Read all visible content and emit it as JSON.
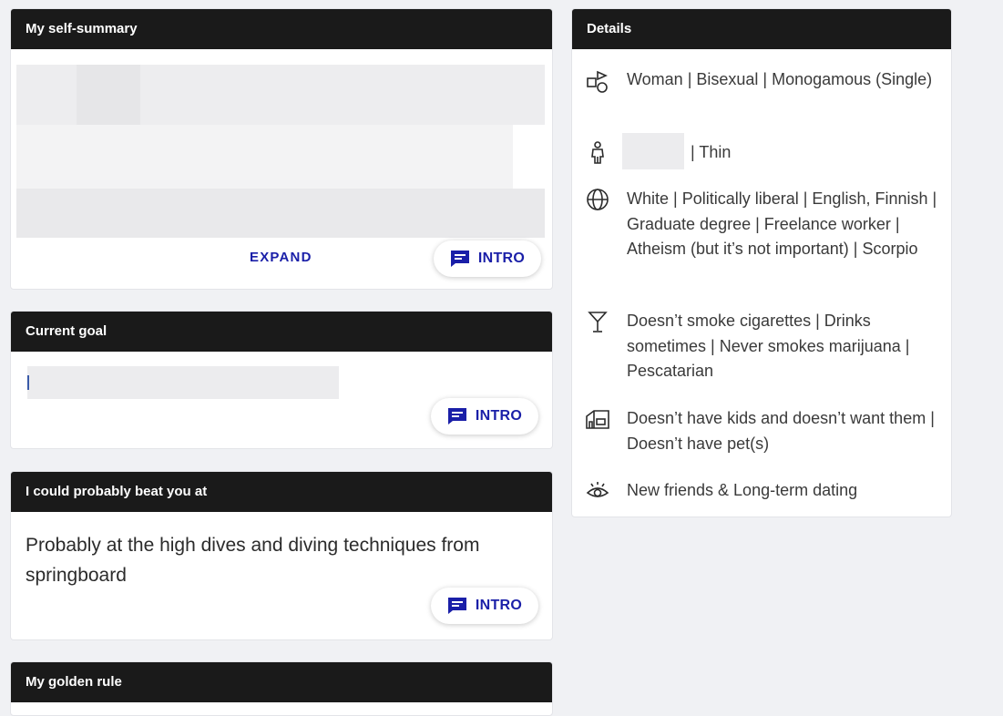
{
  "self_summary": {
    "title": "My self-summary",
    "expand_label": "EXPAND",
    "intro_label": "INTRO"
  },
  "current_goal": {
    "title": "Current goal",
    "intro_label": "INTRO"
  },
  "beat_you": {
    "title": "I could probably beat you at",
    "text": "Probably at the high dives and diving techniques from springboard",
    "intro_label": "INTRO"
  },
  "golden_rule": {
    "title": "My golden rule"
  },
  "details": {
    "title": "Details",
    "rows": [
      {
        "icon": "gender-shapes-icon",
        "text": "Woman | Bisexual | Monogamous (Single)"
      },
      {
        "icon": "body-type-icon",
        "text": "| Thin"
      },
      {
        "icon": "globe-icon",
        "text": "White | Politically liberal | English, Finnish | Graduate degree | Freelance worker | Atheism (but it’s not important) | Scorpio"
      },
      {
        "icon": "cocktail-glass-icon",
        "text": "Doesn’t smoke cigarettes | Drinks sometimes | Never smokes marijuana | Pescatarian"
      },
      {
        "icon": "house-icon",
        "text": "Doesn’t have kids and doesn’t want them | Doesn’t have pet(s)"
      },
      {
        "icon": "eye-icon",
        "text": "New friends & Long-term dating"
      }
    ]
  },
  "colors": {
    "accent": "#1a1fa8",
    "header_bg": "#1a1a1a",
    "page_bg": "#f0f1f4"
  }
}
